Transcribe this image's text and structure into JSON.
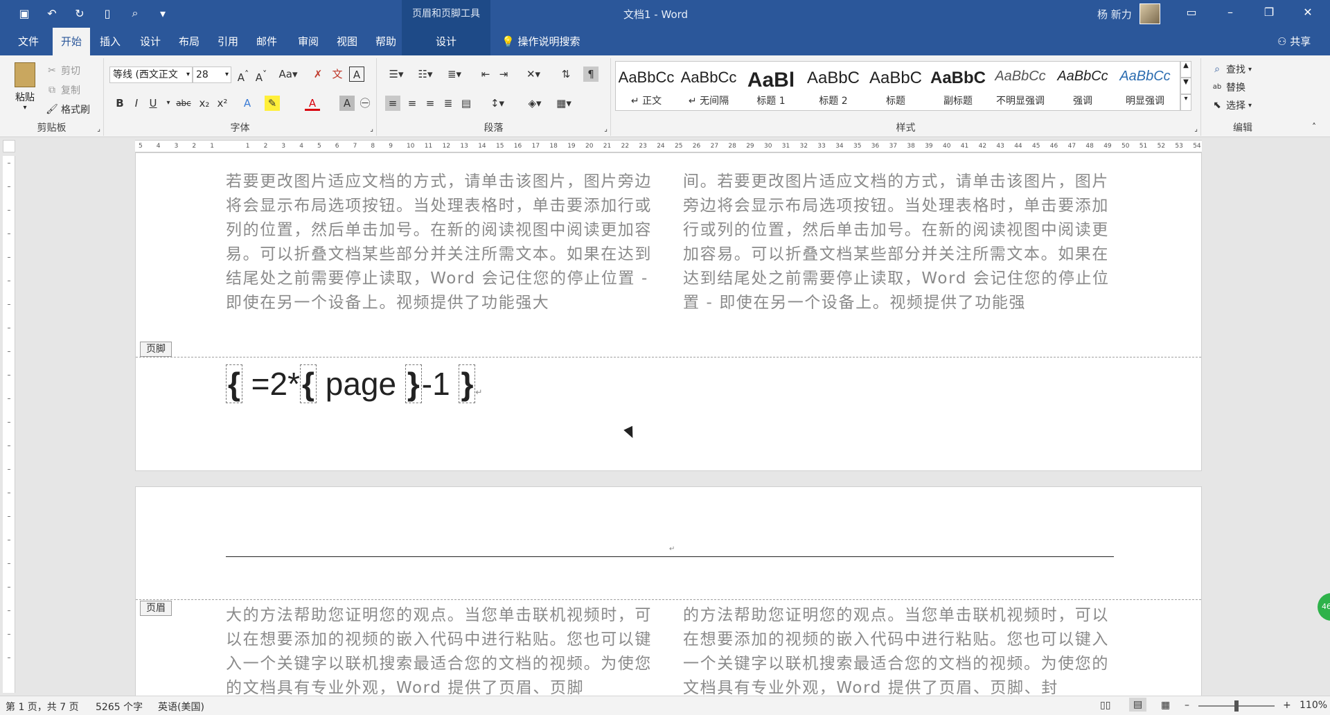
{
  "titlebar": {
    "context_tool": "页眉和页脚工具",
    "doc_title": "文档1  -  Word",
    "user": "杨 新力"
  },
  "tabs": {
    "file": "文件",
    "home": "开始",
    "insert": "插入",
    "design": "设计",
    "layout": "布局",
    "references": "引用",
    "mailings": "邮件",
    "review": "审阅",
    "view": "视图",
    "help": "帮助",
    "ctx_design": "设计",
    "search": "操作说明搜索",
    "share": "共享"
  },
  "ribbon": {
    "clipboard": {
      "paste": "粘贴",
      "cut": "剪切",
      "copy": "复制",
      "format_painter": "格式刷",
      "label": "剪贴板"
    },
    "font": {
      "font_name": "等线 (西文正文",
      "font_size": "28",
      "label": "字体"
    },
    "paragraph": {
      "label": "段落"
    },
    "styles": {
      "label": "样式",
      "items": [
        {
          "sample": "AaBbCc",
          "name": "↵ 正文"
        },
        {
          "sample": "AaBbCc",
          "name": "↵ 无间隔"
        },
        {
          "sample": "AaBl",
          "name": "标题 1"
        },
        {
          "sample": "AaBbC",
          "name": "标题 2"
        },
        {
          "sample": "AaBbC",
          "name": "标题"
        },
        {
          "sample": "AaBbC",
          "name": "副标题"
        },
        {
          "sample": "AaBbCc",
          "name": "不明显强调"
        },
        {
          "sample": "AaBbCc",
          "name": "强调"
        },
        {
          "sample": "AaBbCc",
          "name": "明显强调"
        }
      ]
    },
    "editing": {
      "find": "查找",
      "replace": "替换",
      "select": "选择",
      "label": "编辑"
    }
  },
  "document": {
    "page1_col1": "若要更改图片适应文档的方式，请单击该图片，图片旁边将会显示布局选项按钮。当处理表格时，单击要添加行或列的位置，然后单击加号。在新的阅读视图中阅读更加容易。可以折叠文档某些部分并关注所需文本。如果在达到结尾处之前需要停止读取，Word 会记住您的停止位置 - 即使在另一个设备上。视频提供了功能强大",
    "page1_col2": "间。若要更改图片适应文档的方式，请单击该图片，图片旁边将会显示布局选项按钮。当处理表格时，单击要添加行或列的位置，然后单击加号。在新的阅读视图中阅读更加容易。可以折叠文档某些部分并关注所需文本。如果在达到结尾处之前需要停止读取，Word 会记住您的停止位置 - 即使在另一个设备上。视频提供了功能强",
    "footer_tag": "页脚",
    "field_parts": [
      "{",
      " =2*",
      "{",
      " page ",
      "}",
      "-1 ",
      "}"
    ],
    "header_tag": "页眉",
    "page2_col1": "大的方法帮助您证明您的观点。当您单击联机视频时，可以在想要添加的视频的嵌入代码中进行粘贴。您也可以键入一个关键字以联机搜索最适合您的文档的视频。为使您的文档具有专业外观，Word 提供了页眉、页脚",
    "page2_col2": "的方法帮助您证明您的观点。当您单击联机视频时，可以在想要添加的视频的嵌入代码中进行粘贴。您也可以键入一个关键字以联机搜索最适合您的文档的视频。为使您的文档具有专业外观，Word 提供了页眉、页脚、封"
  },
  "statusbar": {
    "page": "第 1 页，共 7 页",
    "words": "5265 个字",
    "language": "英语(美国)",
    "zoom": "110%",
    "zoom_fraction": 0.5
  },
  "badge": "46"
}
